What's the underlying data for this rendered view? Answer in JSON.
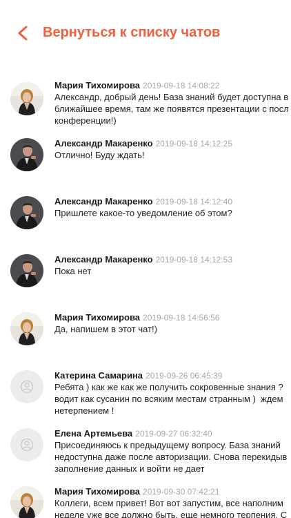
{
  "header": {
    "back_label": "Вернуться к списку чатов"
  },
  "messages": [
    {
      "author": "Мария Тихомирова",
      "time": "2019-09-18 14:08:22",
      "avatar": "photo-woman",
      "lines": [
        "Александр, добрый день! База знаний будет доступна в",
        "ближайшее время, там же появятся презентации с посл",
        "конференции!)"
      ]
    },
    {
      "author": "Александр Макаренко",
      "time": "2019-09-18 14:12:25",
      "avatar": "photo-man",
      "lines": [
        "Отлично! Буду ждать!"
      ]
    },
    {
      "author": "Александр Макаренко",
      "time": "2019-09-18 14:12:40",
      "avatar": "photo-man",
      "lines": [
        "Пришлете какое-то уведомление об этом?"
      ]
    },
    {
      "author": "Александр Макаренко",
      "time": "2019-09-18 14:12:53",
      "avatar": "photo-man",
      "lines": [
        "Пока нет"
      ]
    },
    {
      "author": "Мария Тихомирова",
      "time": "2019-09-18 14:56:56",
      "avatar": "photo-woman",
      "lines": [
        "Да, напишем в этот чат!)"
      ]
    },
    {
      "author": "Катерина Самарина",
      "time": "2019-09-26 06:45:39",
      "avatar": "placeholder",
      "lines": [
        "Ребята ) как же как же получить сокровенные знания ?",
        "водит как сусанин по всяким местам странным )  ждем",
        "нетерпением !"
      ]
    },
    {
      "author": "Елена Артемьева",
      "time": "2019-09-27 06:32:40",
      "avatar": "placeholder",
      "lines": [
        "Присоединяюсь к предыдущему вопросу. База знаний",
        "недоступна даже после авторизации. Снова перекидыв",
        "заполнение данных и войти не дает"
      ]
    },
    {
      "author": "Мария Тихомирова",
      "time": "2019-09-30 07:42:21",
      "avatar": "photo-woman",
      "lines": [
        "Коллеги, всем привет! Вот вот запустим, все наполним",
        "неделе уже все должно быть, еще немного терпения. С"
      ]
    }
  ]
}
